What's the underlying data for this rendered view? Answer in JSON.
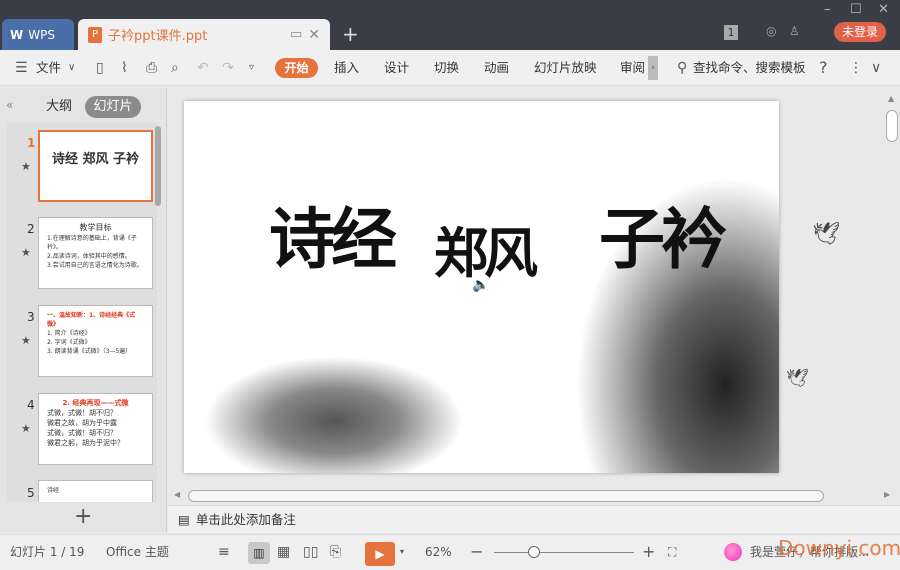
{
  "app": {
    "wps_label": "WPS",
    "doc_tab": "子衿ppt课件.ppt",
    "login": "未登录",
    "badge": "1"
  },
  "toolbar": {
    "file": "文件",
    "tabs": [
      "开始",
      "插入",
      "设计",
      "切换",
      "动画",
      "幻灯片放映",
      "审阅"
    ],
    "search": "查找命令、搜索模板",
    "help": "?"
  },
  "left_panel": {
    "outline_tab": "大纲",
    "slides_tab": "幻灯片",
    "add": "+",
    "thumbnails": [
      {
        "num": "1",
        "lines": [
          "诗经  郑风  子衿"
        ]
      },
      {
        "num": "2",
        "lines": [
          "教学目标",
          "1.在理解诗意的基础上，背诵《子衿》。",
          "2.品读诗词，体验其中的感情。",
          "3.尝试用自己的言语之情化为诗歌。"
        ]
      },
      {
        "num": "3",
        "lines": [
          "一、温故知新：1、诗经经典《式微》",
          "1. 简介《诗经》",
          "2. 字词《式微》",
          "3. 朗读背诵《式微》（3—5遍）"
        ]
      },
      {
        "num": "4",
        "lines": [
          "2. 经典再现——式微",
          "式微，式微！胡不归？",
          "微君之故，胡为乎中露",
          "式微，式微！胡不归？",
          "微君之躬，胡为乎泥中？"
        ]
      },
      {
        "num": "5",
        "lines": [
          "诗经"
        ]
      }
    ]
  },
  "slide": {
    "title_words": [
      "诗经",
      "郑风",
      "子衿"
    ]
  },
  "notes": {
    "placeholder": "单击此处添加备注"
  },
  "status": {
    "slide_counter": "幻灯片 1 / 19",
    "theme": "Office 主题",
    "zoom": "62%",
    "zoom_percent": 62,
    "tip": "我是萱仔，帮你排版...",
    "watermark": "Downyi.com"
  },
  "colors": {
    "accent": "#e4733c",
    "titlebar": "#3a3c46"
  }
}
